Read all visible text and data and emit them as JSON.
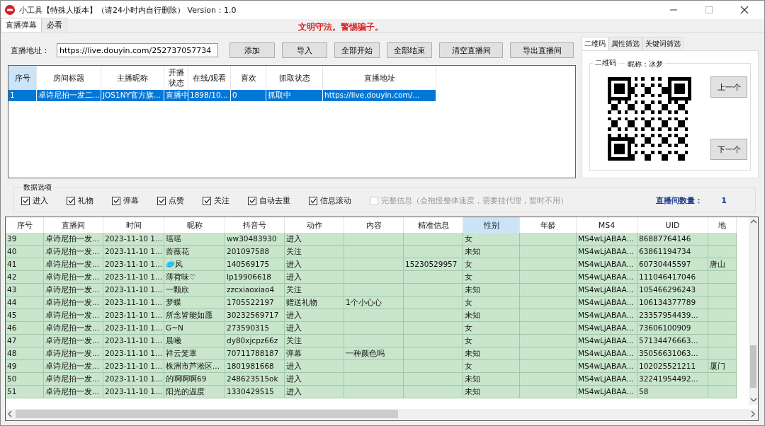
{
  "window": {
    "title": "小工具【特殊人版本】（请24小时内自行删除） Version：1.0"
  },
  "tabs": [
    {
      "label": "直播弹幕",
      "selected": true
    },
    {
      "label": "必看",
      "selected": false
    }
  ],
  "notice": "文明守法。警惕骗子。",
  "address": {
    "label": "直播地址：",
    "value": "https://live.douyin.com/252737057734"
  },
  "buttons": [
    "添加",
    "导入",
    "全部开始",
    "全部结束",
    "清空直播间",
    "导出直播间"
  ],
  "rooms": {
    "columns": [
      "序号",
      "房间标题",
      "主播昵称",
      "开播状态",
      "在线/观看",
      "喜欢",
      "抓取状态",
      "直播地址"
    ],
    "rows": [
      {
        "selected": true,
        "cells": [
          "1",
          "卓诗尼拍一发二...",
          "JOS1NY官方旗...",
          "直播中",
          "1898/10...",
          "0",
          "抓取中",
          "https://live.douyin.com/..."
        ]
      }
    ]
  },
  "side_tabs": [
    {
      "label": "二维码",
      "selected": true
    },
    {
      "label": "属性筛选",
      "selected": false
    },
    {
      "label": "关键词筛选",
      "selected": false
    }
  ],
  "qr_group": {
    "title": "二维码",
    "nickname": "昵称：冰梦",
    "prev": "上一个",
    "next": "下一个"
  },
  "options": {
    "title": "数据选项",
    "items": [
      {
        "label": "进入",
        "checked": true,
        "disabled": false
      },
      {
        "label": "礼物",
        "checked": true,
        "disabled": false
      },
      {
        "label": "弹幕",
        "checked": true,
        "disabled": false
      },
      {
        "label": "点赞",
        "checked": true,
        "disabled": false
      },
      {
        "label": "关注",
        "checked": true,
        "disabled": false
      },
      {
        "label": "自动去重",
        "checked": true,
        "disabled": false
      },
      {
        "label": "信息滚动",
        "checked": true,
        "disabled": false
      },
      {
        "label": "完整信息（会拖慢整体速度，需要挂代理，暂时不用）",
        "checked": false,
        "disabled": true
      }
    ],
    "count_label": "直播间数量：",
    "count": "1"
  },
  "table": {
    "columns": [
      {
        "label": "序号",
        "selected": false
      },
      {
        "label": "直播间",
        "selected": false
      },
      {
        "label": "时间",
        "selected": false
      },
      {
        "label": "昵称",
        "selected": false
      },
      {
        "label": "抖音号",
        "selected": false
      },
      {
        "label": "动作",
        "selected": false
      },
      {
        "label": "内容",
        "selected": false
      },
      {
        "label": "精准信息",
        "selected": false
      },
      {
        "label": "性别",
        "selected": true
      },
      {
        "label": "年龄",
        "selected": false
      },
      {
        "label": "MS4",
        "selected": false
      },
      {
        "label": "UID",
        "selected": false
      },
      {
        "label": "地",
        "selected": false
      }
    ],
    "rows": [
      [
        "39",
        "卓诗尼拍一发...",
        "2023-11-10 1...",
        "瑶瑶",
        "ww30483930",
        "进入",
        "",
        "",
        "女",
        "",
        "MS4wLjABAA...",
        "86887764146",
        ""
      ],
      [
        "40",
        "卓诗尼拍一发...",
        "2023-11-10 1...",
        "蔷薇花",
        "201097588",
        "关注",
        "",
        "",
        "未知",
        "",
        "MS4wLjABAA...",
        "63861194734",
        ""
      ],
      [
        "41",
        "卓诗尼拍一发...",
        "2023-11-10 1...",
        "🥏凤",
        "140569175",
        "进入",
        "",
        "15230529957",
        "女",
        "",
        "MS4wLjABAA...",
        "60730445597",
        "唐山"
      ],
      [
        "42",
        "卓诗尼拍一发...",
        "2023-11-10 1...",
        "薄荷味♡",
        "lp19906618",
        "进入",
        "",
        "",
        "女",
        "",
        "MS4wLjABAA...",
        "111046417046",
        ""
      ],
      [
        "43",
        "卓诗尼拍一发...",
        "2023-11-10 1...",
        "一颗欣",
        "zzcxiaoxiao4",
        "关注",
        "",
        "",
        "未知",
        "",
        "MS4wLjABAA...",
        "105466296243",
        ""
      ],
      [
        "44",
        "卓诗尼拍一发...",
        "2023-11-10 1...",
        "梦蝶",
        "1705522197",
        "赠送礼物",
        "1个小心心",
        "",
        "女",
        "",
        "MS4wLjABAA...",
        "106134377789",
        ""
      ],
      [
        "45",
        "卓诗尼拍一发...",
        "2023-11-10 1...",
        "所念皆能如愿",
        "30232569717",
        "进入",
        "",
        "",
        "未知",
        "",
        "MS4wLjABAA...",
        "23357954439...",
        ""
      ],
      [
        "46",
        "卓诗尼拍一发...",
        "2023-11-10 1...",
        "G~N",
        "273590315",
        "进入",
        "",
        "",
        "女",
        "",
        "MS4wLjABAA...",
        "73606100909",
        ""
      ],
      [
        "47",
        "卓诗尼拍一发...",
        "2023-11-10 1...",
        "晨曦",
        "dy80xjcpz66z",
        "关注",
        "",
        "",
        "女",
        "",
        "MS4wLjABAA...",
        "57134476663...",
        ""
      ],
      [
        "48",
        "卓诗尼拍一发...",
        "2023-11-10 1...",
        "祥云笼罩",
        "70711788187",
        "弹幕",
        "一种颜色吗",
        "",
        "未知",
        "",
        "MS4wLjABAA...",
        "35056631063...",
        ""
      ],
      [
        "49",
        "卓诗尼拍一发...",
        "2023-11-10 1...",
        "株洲市芦淞区...",
        "1801981668",
        "进入",
        "",
        "",
        "女",
        "",
        "MS4wLjABAA...",
        "102025521211",
        "厦门"
      ],
      [
        "50",
        "卓诗尼拍一发...",
        "2023-11-10 1...",
        "的啊啊啊69",
        "248623515ok",
        "进入",
        "",
        "",
        "未知",
        "",
        "MS4wLjABAA...",
        "32241954492...",
        ""
      ],
      [
        "51",
        "卓诗尼拍一发...",
        "2023-11-10 1...",
        "阳光的温度",
        "1330429515",
        "进入",
        "",
        "",
        "未知",
        "",
        "MS4wLjABAA...",
        "58",
        ""
      ]
    ]
  }
}
